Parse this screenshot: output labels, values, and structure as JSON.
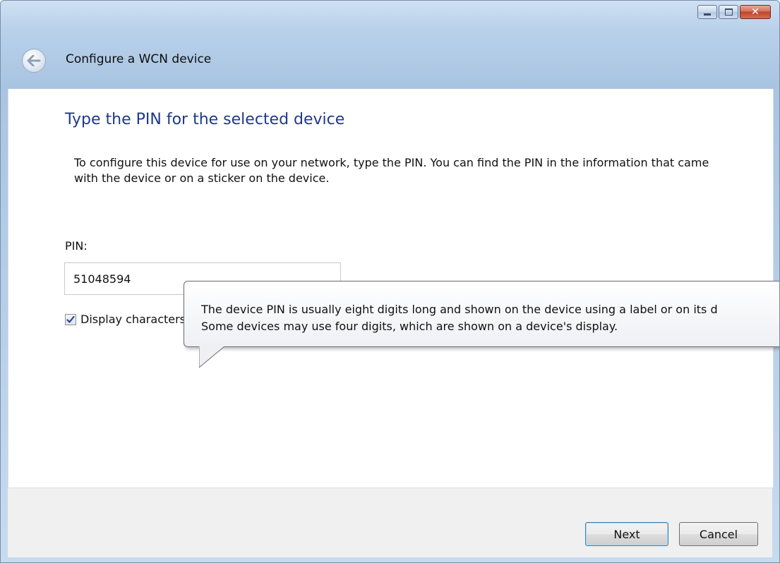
{
  "window": {
    "title": "Configure a WCN device",
    "caption_buttons": [
      "minimize",
      "maximize",
      "close"
    ]
  },
  "page": {
    "heading": "Type the PIN for the selected device",
    "instructions": "To configure this device for use on your network, type the PIN. You can find the PIN in the information that came with the device or on a sticker on the device.",
    "pin_label": "PIN:",
    "pin_value": "51048594",
    "display_characters": {
      "label": "Display characters",
      "checked": true
    }
  },
  "tooltip": {
    "line1": "The device PIN is usually eight digits long and shown on the device using a label or on its d",
    "line2": "Some devices may use four digits, which are shown on a device's display."
  },
  "footer": {
    "next_label": "Next",
    "cancel_label": "Cancel"
  },
  "icons": {
    "back": "back-arrow-icon",
    "minimize": "minimize-icon",
    "maximize": "maximize-icon",
    "close": "close-icon",
    "check": "checkmark-icon"
  },
  "colors": {
    "heading": "#1e3a8a",
    "titlebar": "#b9d1ea",
    "close_button": "#c0432a"
  }
}
